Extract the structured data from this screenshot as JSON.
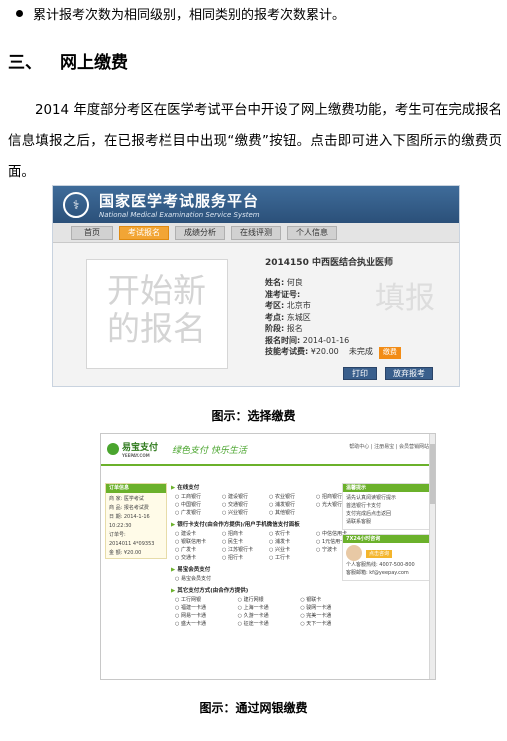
{
  "bullet": "累计报考次数为相同级别，相同类别的报考次数累计。",
  "section": {
    "num": "三、",
    "title": "网上缴费"
  },
  "paragraph": "2014 年度部分考区在医学考试平台中开设了网上缴费功能，考生可在完成报名信息填报之后，在已报考栏目中出现“缴费”按钮。点击即可进入下图所示的缴费页面。",
  "figure1": {
    "site_title": "国家医学考试服务平台",
    "site_subtitle": "National Medical Examination Service System",
    "nav": [
      "首页",
      "考试报名",
      "成绩分析",
      "在线评测",
      "个人信息"
    ],
    "placeholder_text": "开始新的报名",
    "exam_title": "2014150 中西医结合执业医师",
    "fields": [
      {
        "k": "姓名:",
        "v": "何良"
      },
      {
        "k": "准考证号:",
        "v": ""
      },
      {
        "k": "考区:",
        "v": "北京市"
      },
      {
        "k": "考点:",
        "v": "东城区"
      },
      {
        "k": "阶段:",
        "v": "报名"
      },
      {
        "k": "报名时间:",
        "v": "2014-01-16"
      }
    ],
    "fee_label": "技能考试费:",
    "fee_value": "¥20.00",
    "fee_status": "未完成",
    "pay_label": "缴费",
    "watermark": "填报",
    "print_label": "打印",
    "abandon_label": "放弃报考",
    "caption": "图示：选择缴费"
  },
  "figure2": {
    "brand": "易宝支付",
    "brand_en": "YEEPAY.COM",
    "slogan": "绿色支付  快乐生活",
    "toplinks": "帮助中心 | 注册易宝 | 会员营销网站",
    "order_header": "订单信息",
    "order_lines": [
      "商 家: 医学考试",
      "商 品: 报名考试费",
      "日 期: 2014-1-16 10:22:30",
      "订单号:",
      "2014011 4*09353",
      "金 额: ¥20.00"
    ],
    "sec1_title": "在线支付",
    "banks1": [
      "工商银行",
      "建设银行",
      "农业银行",
      "招商银行",
      "中国银行",
      "交通银行",
      "浦发银行",
      "光大银行",
      "广发银行",
      "兴业银行",
      "其他银行"
    ],
    "sec2_title": "银行卡支付(由合作方提供)/用户手机微信支付面板",
    "banks2": [
      "建设卡",
      "招商卡",
      "农行卡",
      "中信信用卡",
      "银联信用卡",
      "民生卡",
      "浦发卡",
      "1元信用卡",
      "广发卡",
      "江苏银行卡",
      "兴业卡",
      "宁波卡",
      "交通卡",
      "招行卡",
      "工行卡"
    ],
    "sec3_title": "易宝会员支付",
    "sec3_item": "易宝会员支付",
    "sec4_title": "其它支付方式(由合作方提供)",
    "banks4": [
      "工行网银",
      "建行网银",
      "银联卡",
      "福建一卡通",
      "上海一卡通",
      "骏网一卡通",
      "网易一卡通",
      "久游一卡通",
      "完美一卡通",
      "盛大一卡通",
      "征途一卡通",
      "天下一卡通"
    ],
    "tips_title": "温馨提示",
    "tips": [
      "请先认真阅读银行提示",
      "首选银行卡支付",
      "支付完成后点击返回",
      "请联系客服"
    ],
    "consult_title": "7X24小时咨询",
    "consult_btn": "点击咨询",
    "hotline": "个人客服热线: 4007-500-800",
    "email": "客服邮箱: kf@yeepay.com",
    "caption": "图示：通过网银缴费"
  }
}
